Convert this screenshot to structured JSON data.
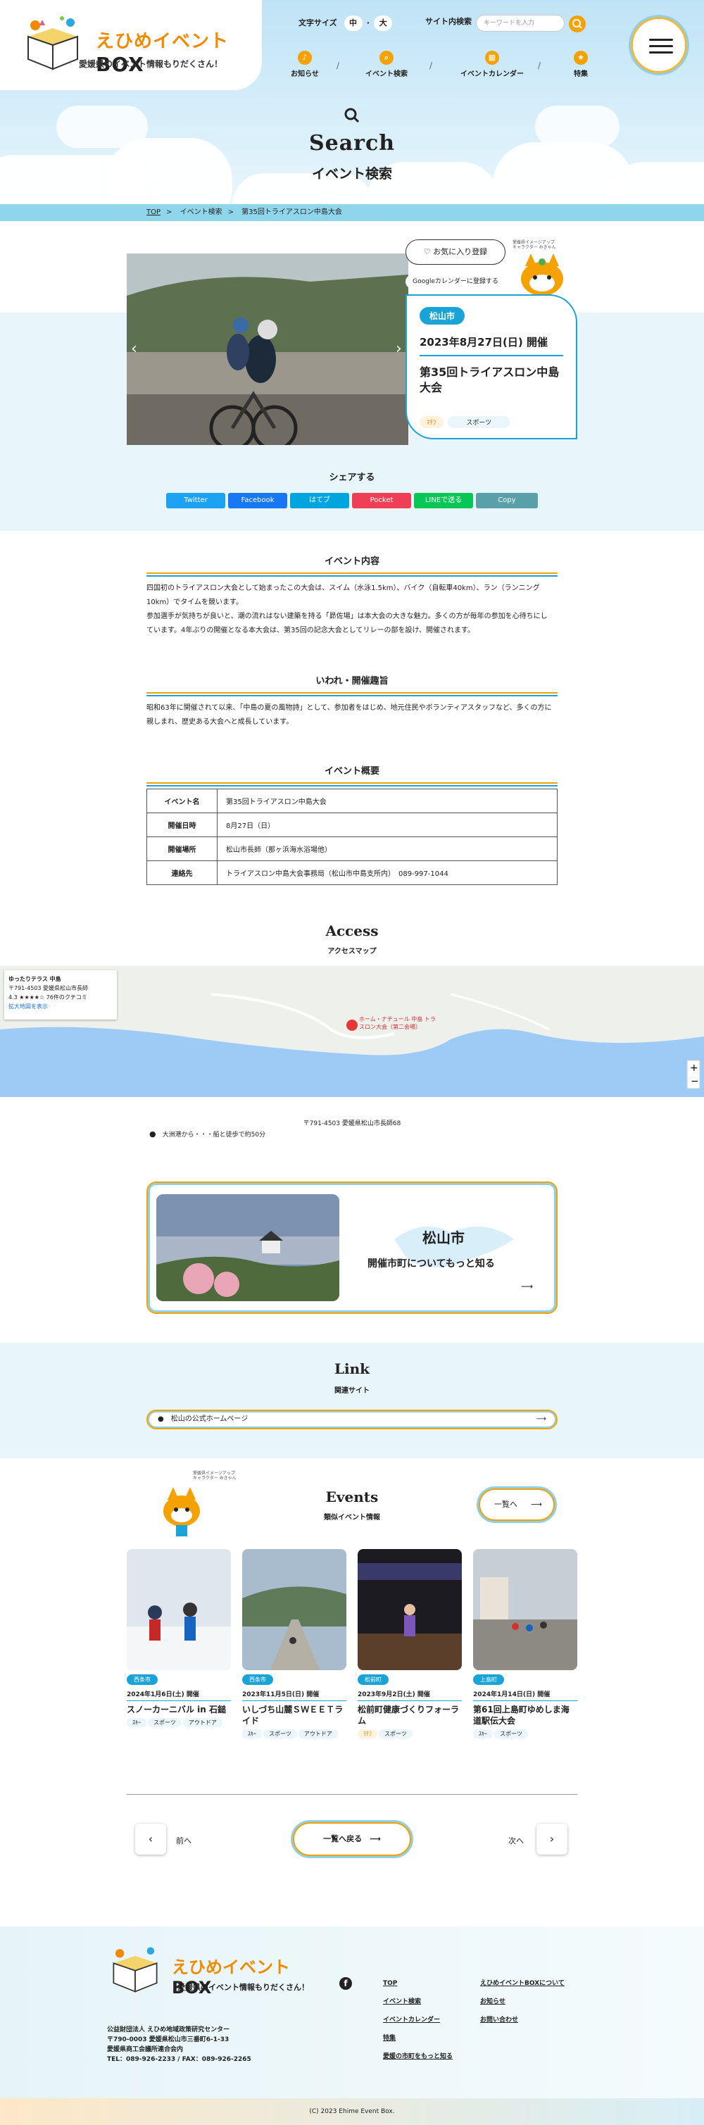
{
  "header": {
    "logo_main": "えひめイベント",
    "logo_box": "BOX",
    "logo_sub": "愛媛県のイベント情報もりだくさん！",
    "font_size_label": "文字サイズ",
    "font_size_medium": "中",
    "font_size_large": "大",
    "site_search_label": "サイト内検索",
    "search_placeholder": "キーワードを入力",
    "nav": [
      {
        "label": "お知らせ",
        "icon": "bell-icon"
      },
      {
        "label": "イベント検索",
        "icon": "search-icon"
      },
      {
        "label": "イベントカレンダー",
        "icon": "calendar-icon"
      },
      {
        "label": "特集",
        "icon": "star-icon"
      }
    ]
  },
  "page_heading": {
    "en": "Search",
    "jp": "イベント検索"
  },
  "breadcrumb": [
    "TOP",
    "イベント検索",
    "第35回トライアスロン中島大会"
  ],
  "event": {
    "favorite_label": "お気に入り登録",
    "gcal_label": "Googleカレンダーに登録する",
    "mascot_note": "愛媛県イメージアップキャラクター みきゃん 許諾番号：11830",
    "city": "松山市",
    "date": "2023年8月27日(日) 開催",
    "title": "第35回トライアスロン中島大会",
    "tags": [
      "ﾏﾁﾌ",
      "スポーツ"
    ]
  },
  "share": {
    "heading": "シェアする",
    "buttons": [
      {
        "label": "Twitter",
        "color": "#1da1f2"
      },
      {
        "label": "Facebook",
        "color": "#1877f2"
      },
      {
        "label": "はてブ",
        "color": "#00a4de"
      },
      {
        "label": "Pocket",
        "color": "#ef3f56"
      },
      {
        "label": "LINEで送る",
        "color": "#06c755"
      },
      {
        "label": "Copy",
        "color": "#5aa0a8"
      }
    ]
  },
  "content": {
    "h1": "イベント内容",
    "p1a": "四国初のトライアスロン大会として始まったこの大会は、スイム（水泳1.5km）、バイク（自転車40km）、ラン（ランニング",
    "p1b": "10km）でタイムを競います。",
    "p1c": "参加選手が気持ちが良いと、潮の流れはない建築を持る「昴佐場」は本大会の大きな魅力。多くの方が毎年の参加を心待ちにし",
    "p1d": "ています。4年ぶりの開催となる本大会は、第35回の記念大会としてリレーの部を設け、開催されます。",
    "h2": "いわれ・開催趣旨",
    "p2a": "昭和63年に開催されて以来、「中島の夏の風物詩」として、参加者をはじめ、地元住民やボランティアスタッフなど、多くの方に",
    "p2b": "親しまれ、歴史ある大会へと成長しています。",
    "h3": "イベント概要"
  },
  "overview": [
    {
      "k": "イベント名",
      "v": "第35回トライアスロン中島大会"
    },
    {
      "k": "開催日時",
      "v": "8月27日（日）"
    },
    {
      "k": "開催場所",
      "v": "松山市長師（那ヶ浜海水浴場他）"
    },
    {
      "k": "連絡先",
      "v": "トライアスロン中島大会事務局（松山市中島支所内）　089-997-1044"
    }
  ],
  "access": {
    "heading": "Access",
    "sub": "アクセスマップ",
    "map_place": "ゆったりテラス 中島",
    "map_addr": "〒791-4503 愛媛県松山市長師",
    "map_rating": "4.3 ★★★★☆ 76件のクチコミ",
    "map_link": "拡大地図を表示",
    "map_pin": "ホーム・ナチュール 中島 トラスロン大会（第二会場）",
    "address": "〒791-4503 愛媛県松山市長師68",
    "route": "大洲港から・・・船と徒歩で約50分"
  },
  "city_link": {
    "name": "松山市",
    "more": "開催市町についてもっと知る"
  },
  "links": {
    "heading": "Link",
    "sub": "関連サイト",
    "item": "松山の公式ホームページ"
  },
  "events": {
    "heading": "Events",
    "sub": "類似イベント情報",
    "more": "一覧へ",
    "items": [
      {
        "city": "西条市",
        "date": "2024年1月6日(土) 開催",
        "title": "スノーカーニバル in 石鎚",
        "tags": [
          "ｽｷｰ",
          "スポーツ",
          "アウトドア"
        ]
      },
      {
        "city": "西条市",
        "date": "2023年11月5日(日) 開催",
        "title": "いしづち山麓ＳＷＥＥＴライド",
        "tags": [
          "ｽｷｰ",
          "スポーツ",
          "アウトドア"
        ]
      },
      {
        "city": "松前町",
        "date": "2023年9月2日(土) 開催",
        "title": "松前町健康づくりフォーラム",
        "tags": [
          "ﾏﾁﾌ",
          "スポーツ"
        ]
      },
      {
        "city": "上島町",
        "date": "2024年1月14日(日) 開催",
        "title": "第61回上島町ゆめしま海道駅伝大会",
        "tags": [
          "ｽｷｰ",
          "スポーツ"
        ]
      }
    ]
  },
  "pager": {
    "prev": "前へ",
    "back": "一覧へ戻る",
    "next": "次へ"
  },
  "footer": {
    "logo_main": "えひめイベント",
    "logo_box": "BOX",
    "logo_sub": "愛媛県のイベント情報もりだくさん！",
    "org1": "公益財団法人 えひめ地域政策研究センター",
    "org2": "〒790-0003 愛媛県松山市三番町6-1-33",
    "org3": "愛媛県商工会議所連合会内",
    "org4": "TEL：089-926-2233 / FAX：089-926-2265",
    "col1": [
      "TOP",
      "イベント検索",
      "イベントカレンダー",
      "特集",
      "愛媛の市町をもっと知る"
    ],
    "col2": [
      "えひめイベントBOXについて",
      "お知らせ",
      "お問い合わせ"
    ],
    "copyright": "(C) 2023 Ehime Event Box."
  }
}
